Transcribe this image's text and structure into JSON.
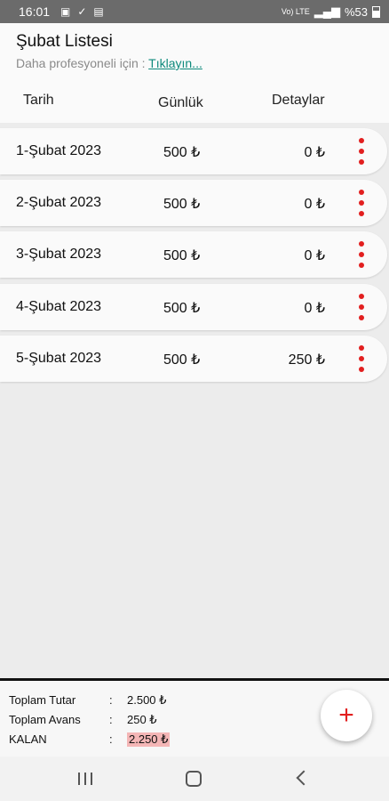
{
  "status": {
    "time": "16:01",
    "left_icons": [
      "image-icon",
      "check-icon",
      "sim-icon"
    ],
    "network": "Vo) LTE",
    "battery_text": "%53"
  },
  "header": {
    "title": "Şubat Listesi",
    "subtitle_prefix": "Daha profesyoneli için : ",
    "subtitle_link": "Tıklayın..."
  },
  "columns": {
    "date": "Tarih",
    "daily": "Günlük",
    "details": "Detaylar"
  },
  "rows": [
    {
      "date": "1-Şubat 2023",
      "daily": "500 ₺",
      "detail": "0 ₺"
    },
    {
      "date": "2-Şubat 2023",
      "daily": "500 ₺",
      "detail": "0 ₺"
    },
    {
      "date": "3-Şubat 2023",
      "daily": "500 ₺",
      "detail": "0 ₺"
    },
    {
      "date": "4-Şubat 2023",
      "daily": "500 ₺",
      "detail": "0 ₺"
    },
    {
      "date": "5-Şubat 2023",
      "daily": "500 ₺",
      "detail": "250 ₺"
    }
  ],
  "summary": {
    "total_label": "Toplam Tutar",
    "total_value": "2.500 ₺",
    "advance_label": "Toplam Avans",
    "advance_value": "250 ₺",
    "remaining_label": "KALAN",
    "remaining_value": "2.250 ₺",
    "colon": ":"
  },
  "fab": {
    "symbol": "+"
  },
  "colors": {
    "accent_red": "#e21f1f",
    "link_teal": "#0e8a7c",
    "remaining_highlight": "#f4b6b6"
  }
}
